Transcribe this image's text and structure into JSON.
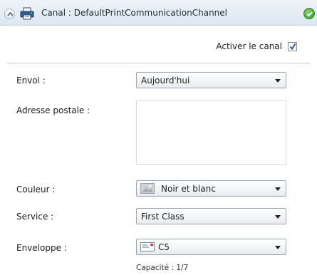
{
  "header": {
    "title": "Canal : DefaultPrintCommunicationChannel",
    "collapse_icon": "chevron-up-icon",
    "channel_icon": "printer-icon",
    "status_icon": "checkmark-icon",
    "status_color": "#3aa32a"
  },
  "activate": {
    "label": "Activer le canal",
    "checked": true
  },
  "form": {
    "envoi": {
      "label": "Envoi :",
      "value": "Aujourd'hui"
    },
    "adresse": {
      "label": "Adresse postale :",
      "value": ""
    },
    "couleur": {
      "label": "Couleur :",
      "value": "Noir et blanc",
      "icon": "color-swatch-icon"
    },
    "service": {
      "label": "Service :",
      "value": "First Class"
    },
    "enveloppe": {
      "label": "Enveloppe :",
      "value": "C5",
      "icon": "envelope-icon"
    }
  },
  "capacity": "Capacité : 1/7"
}
